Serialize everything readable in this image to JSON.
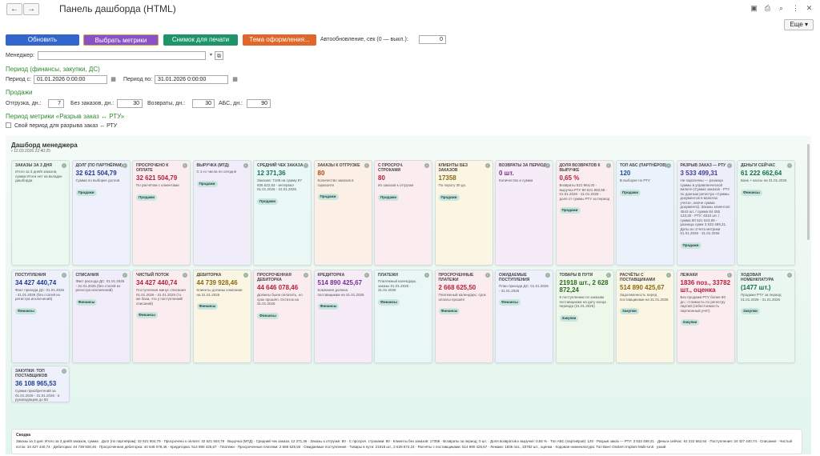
{
  "header": {
    "title": "Панель дашборда (HTML)",
    "back": "←",
    "forward": "→",
    "more_label": "Еще ▾"
  },
  "toolbar": {
    "refresh_label": "Обновить",
    "metrics_label": "Выбрать метрики",
    "snapshot_label": "Снимок для печати",
    "theme_label": "Тема оформления...",
    "autorefresh_label": "Автообновление, сек (0 — выкл.):",
    "autorefresh_value": "0",
    "colors": {
      "refresh": "#3366cc",
      "metrics": "#8a52c8",
      "snapshot": "#1f9469",
      "theme": "#e0662a"
    }
  },
  "filters": {
    "manager_label": "Менеджер:",
    "manager_value": "",
    "period_heading": "Период (финансы, закупки, ДС)",
    "period_from_label": "Период с:",
    "period_from_value": "01.01.2026 0:00:00",
    "period_to_label": "Период по:",
    "period_to_value": "31.01.2026 0:00:00",
    "sales_heading": "Продажи",
    "shipment_label": "Отгрузка, дн.:",
    "shipment_value": "7",
    "no_orders_label": "Без заказов, дн.:",
    "no_orders_value": "30",
    "returns_label": "Возвраты, дн.:",
    "returns_value": "30",
    "abc_label": "АБС, дн.:",
    "abc_value": "90",
    "gap_heading": "Период метрики «Разрыв заказ ↔ РТУ»",
    "gap_checkbox_label": "Свой период для разрыва заказ ↔ РТУ"
  },
  "dashboard": {
    "title": "Дашборд менеджера",
    "timestamp": "• 12.03.2026 22:40:25",
    "row1": [
      {
        "title": "Заказы за 3 дня",
        "value": "",
        "note": "Итого за 3 дня/8 заказов, сумма\n\nИтоги нет на вкладке дашборда",
        "tag": "",
        "bg": "#eaf8f0",
        "color": "#333"
      },
      {
        "title": "Долг (по партнёрам)",
        "value": "32 621 504,79",
        "note": "Сумма по выборке долгов",
        "tag": "Продажи",
        "bg": "#eef1fb",
        "color": "#1d3d8f"
      },
      {
        "title": "Просрочено к оплате",
        "value": "32 621 504,79",
        "note": "По расчётам с клиентами",
        "tag": "Продажи",
        "bg": "#fbecef",
        "color": "#b3203a"
      },
      {
        "title": "Выручка (МТД)",
        "value": "",
        "note": "С 1-го числа по сегодня",
        "tag": "Продажи",
        "bg": "#f1ecfa",
        "color": "#5b2a99"
      },
      {
        "title": "Средний чек заказа",
        "value": "12 371,36",
        "note": "Заказов: 7108 на сумму 87 935 622,83 - интервал 01.01.2026 - 31.01.2026",
        "tag": "Продажи",
        "bg": "#e9f7f5",
        "color": "#1a6e64"
      },
      {
        "title": "Заказы к отгрузке",
        "value": "80",
        "note": "Количество заказов в горизонте",
        "tag": "Продажи",
        "bg": "#fbefe6",
        "color": "#b04a12"
      },
      {
        "title": "С просроч. строками",
        "value": "80",
        "note": "Из заказов к отгрузке",
        "tag": "Продажи",
        "bg": "#fbecef",
        "color": "#b3203a"
      },
      {
        "title": "Клиенты без заказов",
        "value": "17358",
        "note": "По порогу 30 дн.",
        "tag": "Продажи",
        "bg": "#fbf5e4",
        "color": "#8a6a10"
      },
      {
        "title": "Возвраты за период",
        "value": "0 шт.",
        "note": "Количество и сумма",
        "tag": "",
        "bg": "#f5ecf8",
        "color": "#7a2f8f"
      },
      {
        "title": "Доля возвратов к выручке",
        "value": "0,65 %",
        "note": "Возвраты 521 954,00 - выручка РТУ 80 521 893,58 - 01.01.2026 - 31.01.2026 - доля от суммы РТУ за период",
        "tag": "Продажи",
        "bg": "#fbecef",
        "color": "#b3203a"
      },
      {
        "title": "Топ АБС (партнёров)",
        "value": "120",
        "note": "В выборке по РТУ",
        "tag": "Продажи",
        "bg": "#eaf3fb",
        "color": "#1d4f8f"
      },
      {
        "title": "Разрыв заказ — РТУ",
        "value": "3 533 499,31",
        "note": "Не парогичны — разница суммы в управленческой валюте (Сумма заказов - РТУ по данным регистра «Суммы документов в валютах учета», иначе сумма документа). Заказы клиентов: 4543 шт. / сумма 84 055 123,30 - РТУ: 4510 шт. / сумма 80 521 623,99 - разница сумм 3 533 499,31. Даты из отчета метрики 01.01.2026 - 31.01.2026",
        "tag": "Продажи",
        "bg": "#eeeefb",
        "color": "#3d3d99"
      },
      {
        "title": "Деньги сейчас",
        "value": "61 222 662,64",
        "note": "Банк + кассы на 31.01.2026",
        "tag": "Финансы",
        "bg": "#e9f7f0",
        "color": "#1a6e45"
      }
    ],
    "row2": [
      {
        "title": "Поступления",
        "value": "34 427 440,74",
        "note": "Факт прихода ДС: 01.01.2026 - 31.01.2026 (без статей из регистра исключений)",
        "tag": "Финансы",
        "bg": "#eef1fb",
        "color": "#1d3d8f"
      },
      {
        "title": "Списания",
        "value": "",
        "note": "Факт расхода ДС: 01.01.2026 - 31.01.2026 (без статей из регистра исключений)",
        "tag": "Финансы",
        "bg": "#f1ecfa",
        "color": "#5b2a99"
      },
      {
        "title": "Чистый поток",
        "value": "34 427 440,74",
        "note": "Поступления минус списания 01.01.2026 - 31.01.2026 (то же база, что у поступлений/списаний)",
        "tag": "Финансы",
        "bg": "#fbecef",
        "color": "#b3203a"
      },
      {
        "title": "Дебиторка",
        "value": "44 739 928,46",
        "note": "Клиенты должны компании на 31.01.2026",
        "tag": "Финансы",
        "bg": "#fbf5e4",
        "color": "#8a6a10"
      },
      {
        "title": "Просроченная дебиторка",
        "value": "44 646 078,46",
        "note": "Должны были оплатить, но срок прошёл. Остаток на 31.01.2026",
        "tag": "Финансы",
        "bg": "#fbecef",
        "color": "#b3203a"
      },
      {
        "title": "Кредиторка",
        "value": "514 890 425,67",
        "note": "Компания должна поставщикам на 31.01.2026",
        "tag": "Финансы",
        "bg": "#f5ecf8",
        "color": "#7a2f8f"
      },
      {
        "title": "Платежи",
        "value": "",
        "note": "Платежный календарь: заказы 01.01.2026 - 31.01.2026",
        "tag": "Финансы",
        "bg": "#e9f7f5",
        "color": "#1a6e64"
      },
      {
        "title": "Просроченные платежи",
        "value": "2 668 625,50",
        "note": "Платежный календарь: срок оплаты прошёл",
        "tag": "Финансы",
        "bg": "#fbecef",
        "color": "#b3203a"
      },
      {
        "title": "Ожидаемые поступления",
        "value": "",
        "note": "План прихода ДС: 01.01.2026 - 31.01.2026",
        "tag": "Финансы",
        "bg": "#eef1fb",
        "color": "#1d3d8f"
      },
      {
        "title": "Товары в пути",
        "value": "21918 шт., 2 628 872,24",
        "note": "К поступлению по заказам поставщикам на дату конца периода (31.01.2026)",
        "tag": "Закупки",
        "bg": "#edf7ea",
        "color": "#2d6a1e"
      },
      {
        "title": "Расчёты с поставщиками",
        "value": "514 890 425,67",
        "note": "Задолженность перед поставщиками на 31.01.2026",
        "tag": "Закупки",
        "bg": "#fbf5e4",
        "color": "#8a6a10"
      },
      {
        "title": "Лежаки",
        "value": "1836 поз., 33782 шт., оценка",
        "note": "Без продажи РТУ более 90 дн.; стоимость по регистру партий (себестоимость партионный учёт)",
        "tag": "Закупки",
        "bg": "#fbecef",
        "color": "#b3203a"
      },
      {
        "title": "Ходовая номенклатура",
        "value": "(1477 шт.)",
        "note": "Продажи РТУ за период 01.01.2026 - 31.01.2026",
        "tag": "Закупки",
        "bg": "#eaf7f1",
        "color": "#1a6e45"
      }
    ],
    "row3": [
      {
        "title": "Закупки: топ поставщиков",
        "value": "36 108 965,53",
        "note": "Сумма приобретений за 01.01.2026 - 31.01.2026 - в руководящем до 50 поставщиков по объёму",
        "tag": "Закупки",
        "bg": "#eef1fb",
        "color": "#1d3d8f"
      }
    ],
    "summary_title": "Сводка",
    "summary_text": "Заказы за 3 дня: Итого за 3 дня/8 заказов, сумма · Долг (по партнёрам): 32 621 504,79 · Просрочено к оплате: 32 621 504,79 · Выручка (МТД) · Средний чек заказа: 12 371,36 · Заказы к отгрузке: 80 · С просроч. строками: 80 · Клиенты без заказов: 17358 · Возвраты за период: 0 шт. · Доля возвратов к выручке: 0,65 % · Топ АБС (партнёров): 120 · Разрыв заказ — РТУ: 3 533 499,31 · Деньги сейчас: 61 222 662,64 · Поступления: 34 427 440,74 · Списания · Чистый поток: 34 427 440,74 · Дебиторка: 44 739 928,46 · Просроченная дебиторка: 44 646 078,46 · Кредиторка: 514 890 425,67 · Платежи · Просроченные платежи: 2 668 625,50 · Ожидаемые поступления · Товары в пути: 21918 шт., 2 628 872,24 · Расчёты с поставщиками: 514 890 425,67 · Лежаки: 1836 поз., 33782 шт., оценка · Ходовая номенклатура: Топ Винт Osstem Implant Multi-Unit · узкий"
  }
}
